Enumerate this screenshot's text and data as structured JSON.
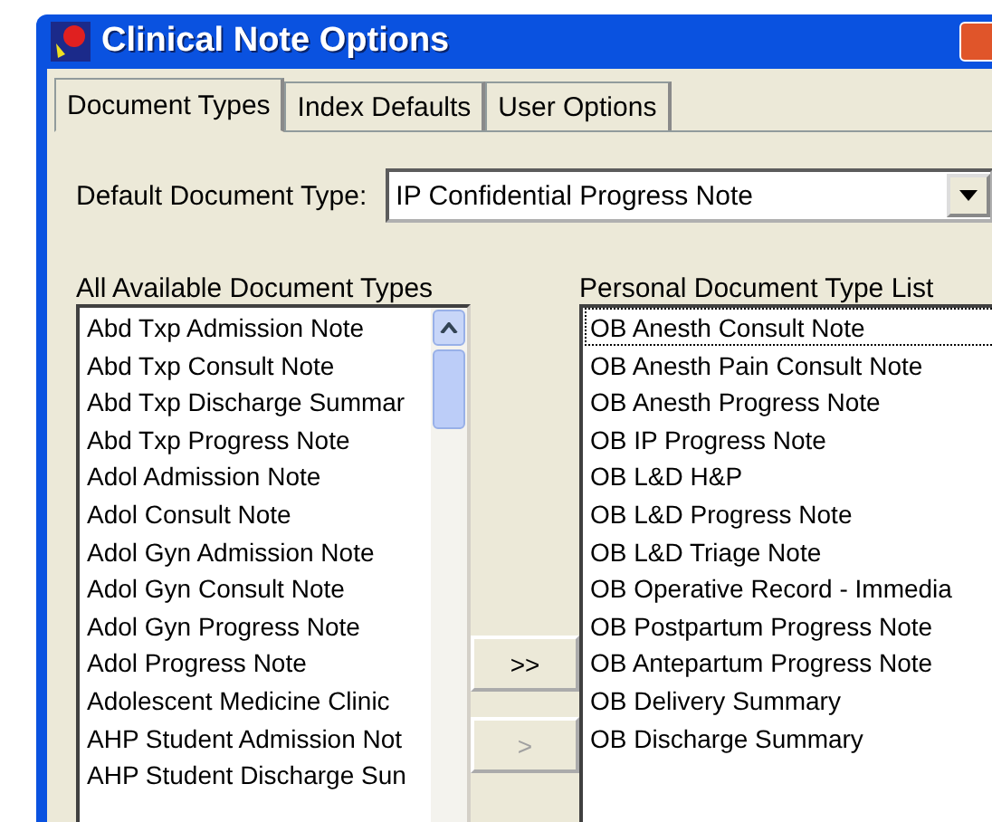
{
  "window": {
    "title": "Clinical Note Options"
  },
  "tabs": [
    {
      "label": "Document Types",
      "selected": true
    },
    {
      "label": "Index Defaults",
      "selected": false
    },
    {
      "label": "User Options",
      "selected": false
    }
  ],
  "default_document_type": {
    "label": "Default Document Type:",
    "value": "IP Confidential Progress Note"
  },
  "available_list": {
    "label": "All Available Document Types",
    "items": [
      "Abd Txp Admission Note",
      "Abd Txp Consult Note",
      "Abd Txp Discharge Summar",
      "Abd Txp Progress Note",
      "Adol Admission Note",
      "Adol Consult Note",
      "Adol Gyn Admission Note",
      "Adol Gyn Consult Note",
      "Adol Gyn Progress Note",
      "Adol Progress Note",
      "Adolescent Medicine Clinic",
      "AHP Student Admission Not",
      "AHP Student Discharge Sun"
    ]
  },
  "buttons": [
    {
      "label": ">>",
      "disabled": false
    },
    {
      "label": ">",
      "disabled": true
    }
  ],
  "personal_list": {
    "label": "Personal Document Type List",
    "items": [
      {
        "text": "OB Anesth Consult Note",
        "focused": true
      },
      {
        "text": "OB Anesth Pain Consult Note",
        "focused": false
      },
      {
        "text": "OB Anesth Progress Note",
        "focused": false
      },
      {
        "text": "OB IP Progress Note",
        "focused": false
      },
      {
        "text": "OB L&D H&P",
        "focused": false
      },
      {
        "text": "OB L&D Progress Note",
        "focused": false
      },
      {
        "text": "OB L&D Triage Note",
        "focused": false
      },
      {
        "text": "OB Operative Record - Immedia",
        "focused": false
      },
      {
        "text": "OB Postpartum Progress Note",
        "focused": false
      },
      {
        "text": "OB Antepartum Progress Note",
        "focused": false
      },
      {
        "text": "OB Delivery Summary",
        "focused": false
      },
      {
        "text": "OB Discharge Summary",
        "focused": false
      }
    ]
  }
}
